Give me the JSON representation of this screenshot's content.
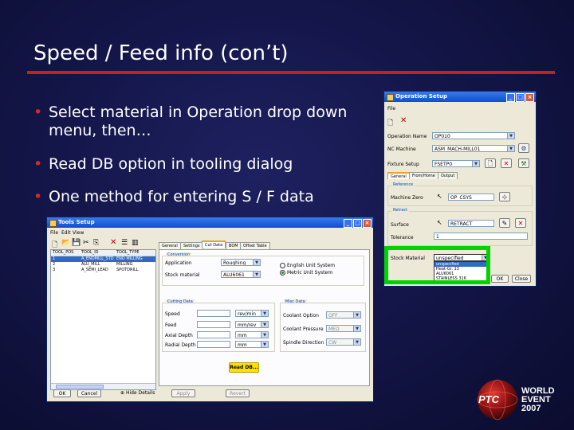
{
  "slide": {
    "title": "Speed / Feed info (con’t)",
    "bullets": [
      "Select material in Operation drop down menu, then…",
      "Read DB option in tooling  dialog",
      "One method for entering S / F data"
    ]
  },
  "operation_setup": {
    "title": "Operation Setup",
    "menu": "File",
    "operation_name_label": "Operation Name",
    "operation_name_value": "OP010",
    "nc_machine_label": "NC Machine",
    "nc_machine_value": "ASM_MACH-MILL01",
    "fixture_setup_label": "Fixture Setup",
    "fixture_setup_value": "FSETP0",
    "tabs": [
      "General",
      "From/Home",
      "Output"
    ],
    "reference_group": "Reference",
    "machine_zero_label": "Machine Zero",
    "machine_zero_value": "OP_CSYS",
    "retract_group": "Retract",
    "surface_label": "Surface",
    "surface_value": "RETRACT",
    "tolerance_label": "Tolerance",
    "tolerance_value": "1",
    "stock_material_label": "Stock Material",
    "stock_material_selected": "unspecified",
    "stock_material_options": [
      "unspecified",
      "Heat-Gr. 13",
      "ALU6061",
      "STAINLESS 316"
    ],
    "ok_label": "OK",
    "cancel_label": "Close"
  },
  "tools_setup": {
    "title": "Tools Setup",
    "menu": [
      "File",
      "Edit",
      "View"
    ],
    "table_headers": [
      "TOOL_POS",
      "TOOL_ID",
      "TOOL_TYPE"
    ],
    "table_rows": [
      [
        "1",
        "A_ENDMILL_STD",
        "END MILLING"
      ],
      [
        "2",
        "ALU_MILL",
        "MILLING"
      ],
      [
        "3",
        "A_SEMI_LEAD",
        "SPOTDRILL"
      ]
    ],
    "tabs": [
      "General",
      "Settings",
      "Cut Data",
      "BOM",
      "Offset Table"
    ],
    "conversion_group": "Conversion",
    "application_label": "Application",
    "application_value": "Roughing",
    "stock_material_label": "Stock material",
    "stock_material_value": "ALU6061",
    "unit_english": "English Unit System",
    "unit_metric": "Metric Unit System",
    "cutting_data_group": "Cutting Data",
    "speed_label": "Speed",
    "feed_label": "Feed",
    "axial_depth_label": "Axial Depth",
    "radial_depth_label": "Radial Depth",
    "speed_unit": "rev/min",
    "feed_unit": "mm/rev",
    "axial_unit": "mm",
    "radial_unit": "mm",
    "misc_group": "Misc Data",
    "coolant_option_label": "Coolant Option",
    "coolant_option_value": "OFF",
    "coolant_pressure_label": "Coolant Pressure",
    "coolant_pressure_value": "MED",
    "spindle_direction_label": "Spindle Direction",
    "spindle_direction_value": "CW",
    "read_db_label": "Read DB...",
    "ok_label": "OK",
    "cancel_label": "Cancel",
    "hide_details_label": "Hide Details",
    "apply_label": "Apply",
    "revert_label": "Revert"
  },
  "logo": {
    "brand": "PTC",
    "event_line1": "WORLD",
    "event_line2": "EVENT",
    "event_year": "2007"
  },
  "colors": {
    "background": "#14164a",
    "title_rule": "#c8201f",
    "bullet": "#d62a24",
    "highlight": "#00d400",
    "read_db": "#ffe000"
  }
}
